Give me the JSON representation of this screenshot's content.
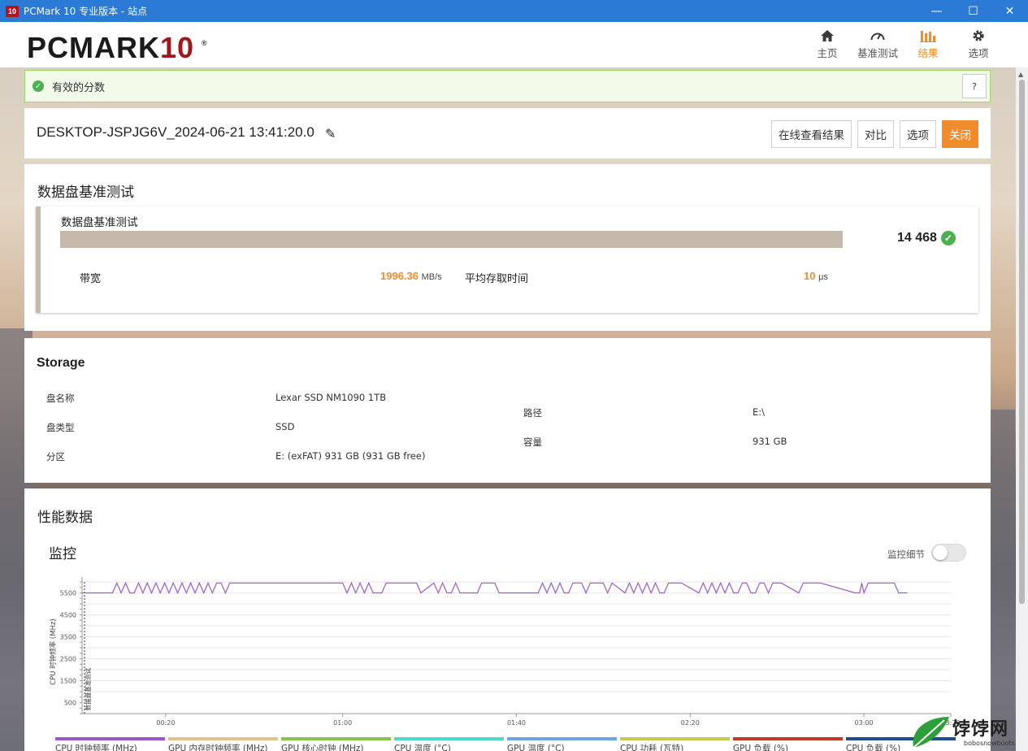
{
  "window": {
    "title": "PCMark 10 专业版本 - 站点",
    "icon_text": "10",
    "minimize": "—",
    "maximize": "☐",
    "close": "✕"
  },
  "header": {
    "logo_main": "PCMARK",
    "logo_num": "10",
    "logo_reg": "®",
    "nav": [
      {
        "label": "主页",
        "icon": "home-icon"
      },
      {
        "label": "基准测试",
        "icon": "gauge-icon"
      },
      {
        "label": "结果",
        "icon": "bar-chart-icon",
        "active": true
      },
      {
        "label": "选项",
        "icon": "gear-icon"
      }
    ]
  },
  "valid": {
    "text": "有效的分数",
    "help": "?"
  },
  "result": {
    "title": "DESKTOP-JSPJG6V_2024-06-21 13:41:20.0",
    "buttons": {
      "online": "在线查看结果",
      "compare": "对比",
      "options": "选项",
      "close": "关闭"
    }
  },
  "benchmark": {
    "section_title": "数据盘基准测试",
    "name": "数据盘基准测试",
    "score": "14 468",
    "bar_fill_ratio": 1.0,
    "bandwidth_label": "带宽",
    "bandwidth_value": "1996.36",
    "bandwidth_unit": "MB/s",
    "access_label": "平均存取时间",
    "access_value": "10",
    "access_unit": "μs"
  },
  "storage": {
    "title": "Storage",
    "disk_name_label": "盘名称",
    "disk_name": "Lexar SSD NM1090 1TB",
    "disk_type_label": "盘类型",
    "disk_type": "SSD",
    "partition_label": "分区",
    "partition": "E: (exFAT) 931 GB (931 GB free)",
    "path_label": "路径",
    "path": "E:\\",
    "capacity_label": "容量",
    "capacity": "931 GB"
  },
  "performance": {
    "title": "性能数据",
    "monitor_title": "监控",
    "toggle_label": "监控细节",
    "toggle_on": false
  },
  "chart_data": {
    "type": "line",
    "ylabel": "CPU 时钟频率 (MHz)",
    "annotation": "数据盘基准测试",
    "yticks": [
      500,
      1500,
      2500,
      3500,
      4500,
      5500
    ],
    "ylim": [
      0,
      6000
    ],
    "xticks": [
      "00:20",
      "01:00",
      "01:40",
      "02:20",
      "03:00",
      "03:20"
    ],
    "xlim": [
      0,
      200
    ],
    "grid": true,
    "series": [
      {
        "name": "CPU 时钟频率 (MHz)",
        "color": "#9b59c6",
        "x": [
          0,
          7,
          8,
          9,
          10,
          11,
          12,
          13,
          14,
          15,
          16,
          17,
          18,
          19,
          20,
          21,
          22,
          23,
          24,
          25,
          26,
          27,
          28,
          29,
          30,
          31,
          32,
          33,
          34,
          35,
          36,
          37,
          38,
          39,
          40,
          59,
          60,
          61,
          62,
          63,
          64,
          65,
          66,
          67,
          69,
          70,
          71,
          77,
          78,
          81,
          82,
          83,
          84,
          85,
          86,
          87,
          88,
          91,
          92,
          95,
          96,
          105,
          106,
          107,
          108,
          109,
          110,
          111,
          112,
          113,
          114,
          115,
          116,
          117,
          118,
          119,
          120,
          121,
          122,
          125,
          126,
          127,
          128,
          129,
          130,
          131,
          132,
          133,
          134,
          135,
          136,
          137,
          138,
          142,
          143,
          144,
          145,
          146,
          147,
          148,
          149,
          150,
          151,
          152,
          153,
          154,
          155,
          156,
          157,
          158,
          159,
          160,
          161,
          165,
          166,
          167,
          168,
          169,
          170,
          178,
          179,
          179.5,
          180,
          181,
          182,
          187,
          188,
          190
        ],
        "y": [
          5500,
          5500,
          5950,
          5500,
          5950,
          5500,
          5500,
          5950,
          5500,
          5950,
          5500,
          5950,
          5500,
          5950,
          5500,
          5950,
          5500,
          5950,
          5500,
          5950,
          5500,
          5950,
          5500,
          5950,
          5500,
          5950,
          5950,
          5500,
          5950,
          5950,
          5950,
          5950,
          5950,
          5950,
          5950,
          5950,
          5950,
          5500,
          5950,
          5500,
          5950,
          5500,
          5950,
          5500,
          5500,
          5950,
          5950,
          5950,
          5500,
          5950,
          5500,
          5950,
          5500,
          5500,
          5950,
          5500,
          5500,
          5500,
          5950,
          5950,
          5500,
          5500,
          5950,
          5500,
          5950,
          5500,
          5950,
          5500,
          5500,
          5950,
          5950,
          5950,
          5500,
          5950,
          5950,
          5950,
          5950,
          5500,
          5950,
          5500,
          5950,
          5500,
          5950,
          5500,
          5950,
          5500,
          5950,
          5500,
          5500,
          5950,
          5950,
          5950,
          5950,
          5500,
          5950,
          5500,
          5950,
          5500,
          5950,
          5500,
          5950,
          5500,
          5500,
          5950,
          5950,
          5500,
          5500,
          5950,
          5950,
          5500,
          5950,
          5950,
          5950,
          5500,
          5950,
          5950,
          5950,
          5950,
          5950,
          5500,
          5500,
          5950,
          5500,
          5950,
          5950,
          5950,
          5500,
          5500
        ]
      }
    ]
  },
  "legend": [
    {
      "label": "CPU 时钟频率 (MHz)",
      "color": "#9b59c6"
    },
    {
      "label": "GPU 内存时钟频率 (MHz)",
      "color": "#e0c48a"
    },
    {
      "label": "GPU 核心时钟 (MHz)",
      "color": "#8bc34a"
    },
    {
      "label": "CPU 温度 (°C)",
      "color": "#4dd9c9"
    },
    {
      "label": "GPU 温度 (°C)",
      "color": "#6aa7e0"
    },
    {
      "label": "CPU 功耗 (瓦特)",
      "color": "#c8c850"
    },
    {
      "label": "GPU 负载 (%)",
      "color": "#c0392b"
    },
    {
      "label": "CPU 负载 (%)",
      "color": "#1f4e8c"
    }
  ],
  "watermark": {
    "text": "饽饽网",
    "url": "bobosnowboots"
  }
}
